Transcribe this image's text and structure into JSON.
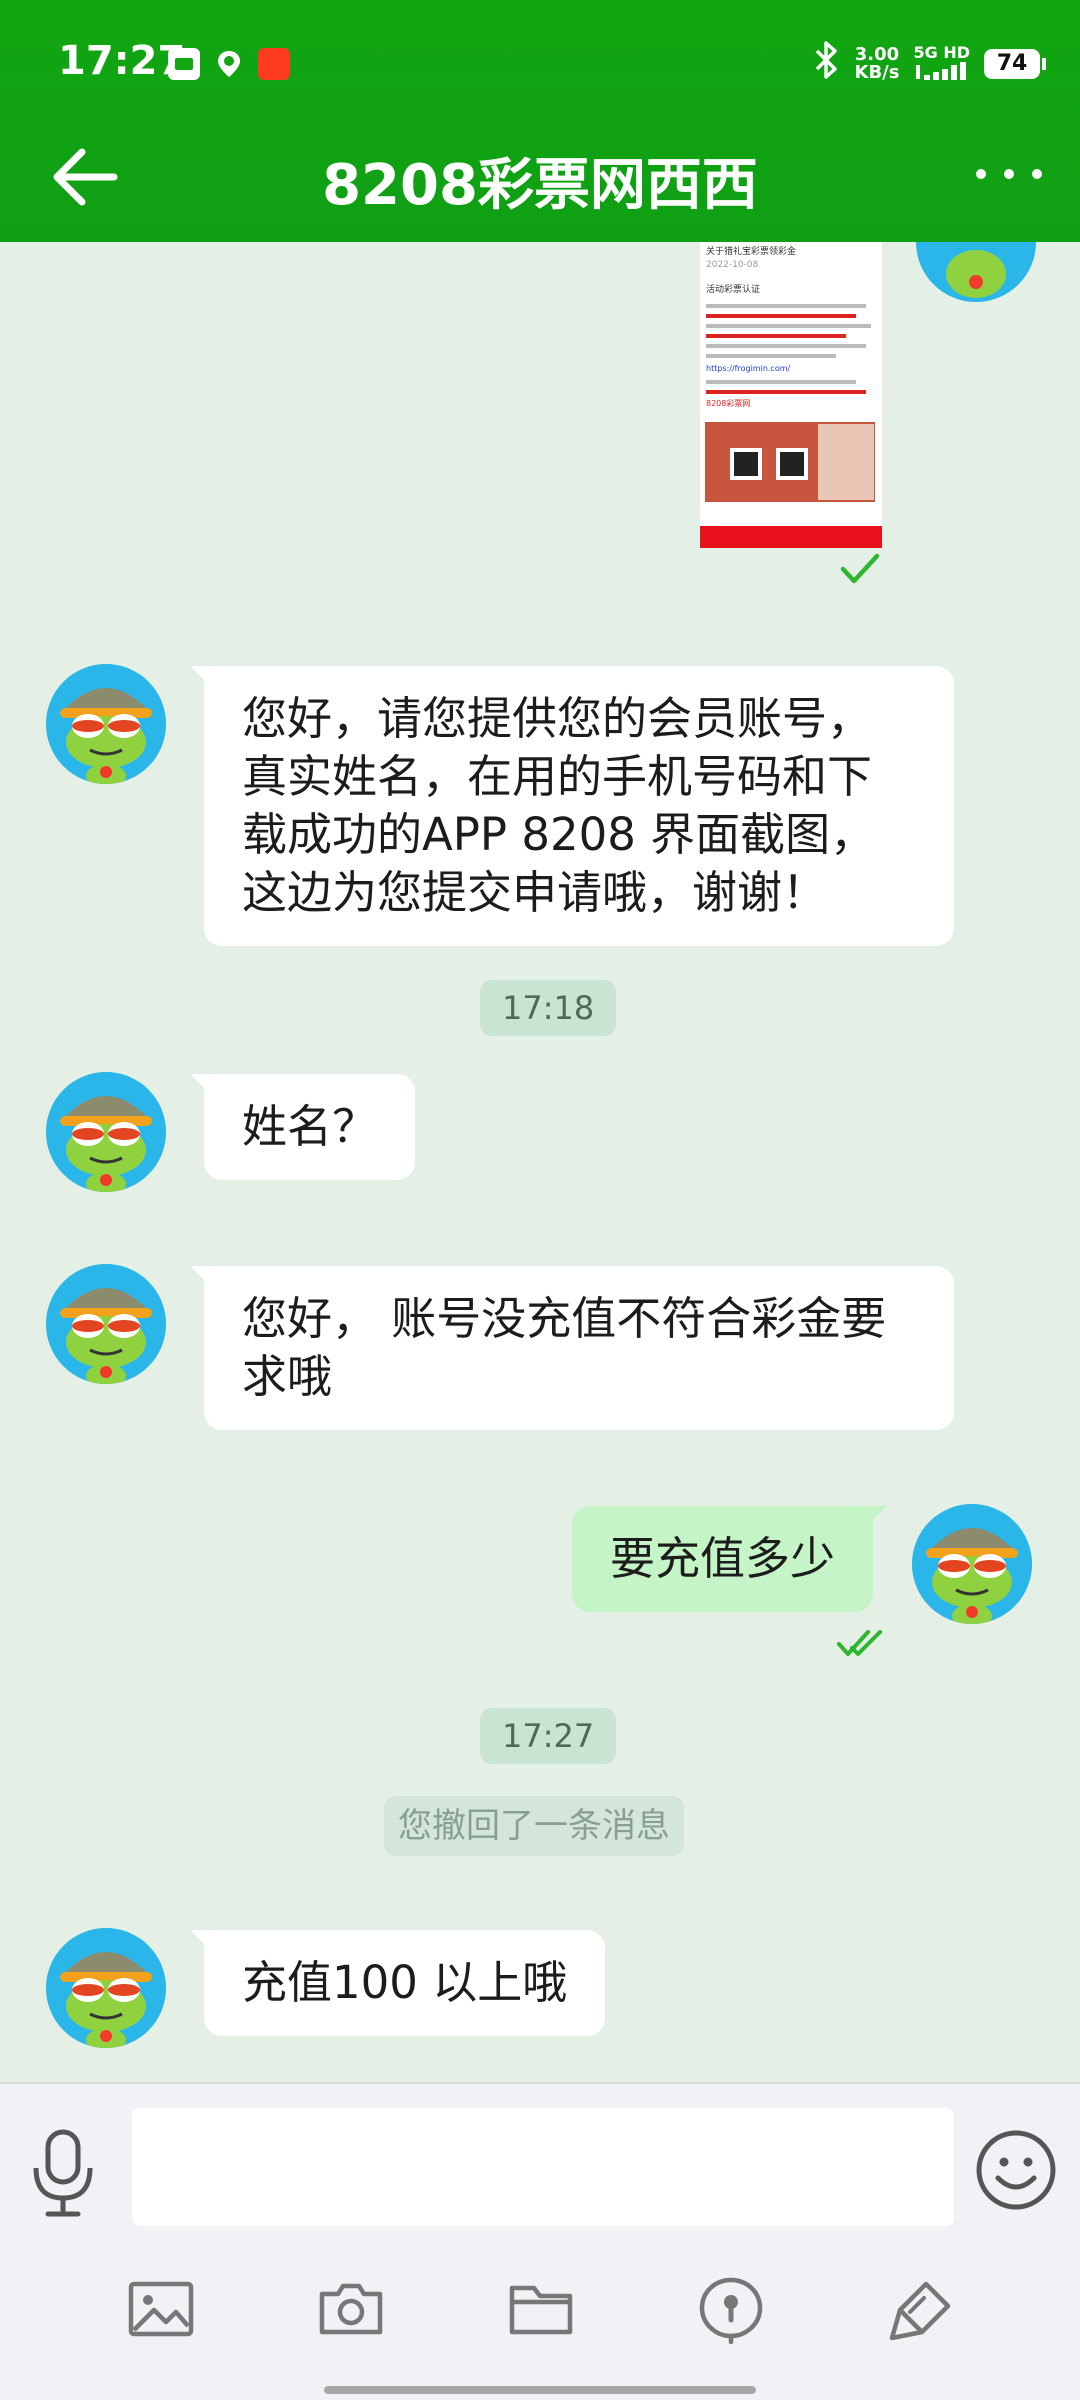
{
  "status_bar": {
    "time": "17:27",
    "net_speed": "3.00",
    "net_speed_unit": "KB/s",
    "network": "5G HD",
    "battery": "74"
  },
  "header": {
    "title": "8208彩票网西西"
  },
  "messages": [
    {
      "type": "image",
      "side": "right",
      "caption_lines": [
        "关于猎礼宝彩票领彩金",
        "2022-10-08",
        "活动彩票认证"
      ],
      "link_text": "https://frogimin.com/",
      "code_text": "8208彩票网",
      "read": true
    },
    {
      "type": "text",
      "side": "left",
      "text": "您好，请您提供您的会员账号，真实姓名，在用的手机号码和下载成功的APP 8208 界面截图，这边为您提交申请哦，谢谢！"
    },
    {
      "type": "time",
      "text": "17:18"
    },
    {
      "type": "text",
      "side": "left",
      "text": "姓名？"
    },
    {
      "type": "text",
      "side": "left",
      "text": "您好， 账号没充值不符合彩金要求哦"
    },
    {
      "type": "text",
      "side": "right",
      "text": "要充值多少",
      "read": true
    },
    {
      "type": "time",
      "text": "17:27"
    },
    {
      "type": "notice",
      "text": "您撤回了一条消息"
    },
    {
      "type": "text",
      "side": "left",
      "text": "充值100 以上哦"
    }
  ],
  "input": {
    "value": "",
    "placeholder": ""
  },
  "toolbar": {
    "items": [
      "image-icon",
      "camera-icon",
      "folder-icon",
      "location-pin-icon",
      "pen-edit-icon"
    ]
  },
  "colors": {
    "header": "#12a612",
    "chat_bg": "#e4efe6",
    "incoming_bubble": "#ffffff",
    "outgoing_bubble": "#c5f5c7",
    "check": "#2fb62f"
  }
}
